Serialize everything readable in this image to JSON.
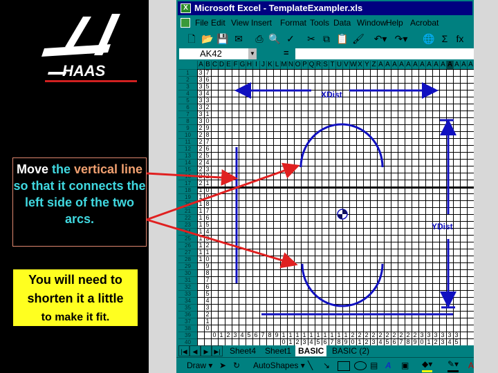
{
  "logo": {
    "text": "HAAS",
    "accent": "#d02020"
  },
  "callout": {
    "w1": "Move ",
    "w2": "the ",
    "w3": "vertical line",
    "w4": " so that it connects the left side of the two arcs."
  },
  "note": {
    "line1": "You will need to",
    "line2": "shorten it a little",
    "line3": "to make it fit."
  },
  "excel": {
    "title": "Microsoft Excel - TemplateExampler.xls",
    "menu": [
      "File",
      "Edit",
      "View",
      "Insert",
      "Format",
      "Tools",
      "Data",
      "Window",
      "Help",
      "Acrobat"
    ],
    "toolbar": [
      "new-icon",
      "open-icon",
      "save-icon",
      "email-icon",
      "print-icon",
      "print-preview-icon",
      "spelling-icon",
      "cut-icon",
      "copy-icon",
      "paste-icon",
      "format-painter-icon",
      "undo-icon",
      "redo-icon",
      "hyperlink-icon",
      "autosum-icon",
      "function-icon"
    ],
    "name_box": "AK42",
    "formula_eq": "=",
    "formula_value": "",
    "columns": [
      "A",
      "B",
      "C",
      "D",
      "E",
      "F",
      "G",
      "H",
      "I",
      "J",
      "K",
      "L",
      "M",
      "N",
      "O",
      "P",
      "Q",
      "R",
      "S",
      "T",
      "U",
      "V",
      "W",
      "X",
      "Y",
      "Z",
      "A",
      "A",
      "A",
      "A",
      "A",
      "A",
      "A",
      "A",
      "A",
      "A",
      "A",
      "A",
      "A",
      "A"
    ],
    "selected_column": "AK",
    "rows": [
      "1",
      "2",
      "3",
      "4",
      "5",
      "6",
      "7",
      "8",
      "9",
      "10",
      "11",
      "12",
      "13",
      "14",
      "15",
      "16",
      "17",
      "18",
      "19",
      "20",
      "21",
      "22",
      "23",
      "24",
      "25",
      "26",
      "27",
      "28",
      "29",
      "30",
      "31",
      "32",
      "33",
      "34",
      "35",
      "36",
      "37",
      "38",
      "39",
      "40"
    ],
    "colA": [
      "3",
      "3",
      "3",
      "3",
      "3",
      "3",
      "3",
      "3",
      "2",
      "2",
      "2",
      "2",
      "2",
      "2",
      "2",
      "2",
      "2",
      "1",
      "1",
      "1",
      "1",
      "1",
      "1",
      "1",
      "1",
      "1",
      "1",
      "1",
      "",
      "",
      "",
      "",
      "",
      "",
      "",
      "",
      "",
      ""
    ],
    "colB": [
      "7",
      "6",
      "5",
      "4",
      "3",
      "2",
      "1",
      "0",
      "9",
      "8",
      "7",
      "6",
      "5",
      "4",
      "3",
      "2",
      "1",
      "0",
      "9",
      "8",
      "7",
      "6",
      "5",
      "4",
      "3",
      "2",
      "1",
      "0",
      "9",
      "8",
      "7",
      "6",
      "5",
      "4",
      "3",
      "2",
      "1",
      "0"
    ],
    "row39": [
      "0",
      "1",
      "2",
      "3",
      "4",
      "5",
      "6",
      "7",
      "8",
      "9",
      "1",
      "1",
      "1",
      "1",
      "1",
      "1",
      "1",
      "1",
      "1",
      "1",
      "2",
      "2",
      "2",
      "2",
      "2",
      "2",
      "2",
      "2",
      "2",
      "2",
      "3",
      "3",
      "3",
      "3",
      "3",
      "3"
    ],
    "row40": [
      "",
      "",
      "",
      "",
      "",
      "",
      "",
      "",
      "",
      "",
      "0",
      "1",
      "2",
      "3",
      "4",
      "5",
      "6",
      "7",
      "8",
      "9",
      "0",
      "1",
      "2",
      "3",
      "4",
      "5",
      "6",
      "7",
      "8",
      "9",
      "0",
      "1",
      "2",
      "3",
      "4",
      "5"
    ],
    "drawing": {
      "xdist": "XDist",
      "ydist": "YDist",
      "shape_color": "#1010c0",
      "arrow_color": "#e02020"
    },
    "sheet_tabs": [
      "Sheet4",
      "Sheet1",
      "BASIC",
      "BASIC (2)"
    ],
    "active_tab": "BASIC",
    "draw_toolbar": {
      "draw": "Draw ▾",
      "autoshapes": "AutoShapes ▾"
    }
  }
}
